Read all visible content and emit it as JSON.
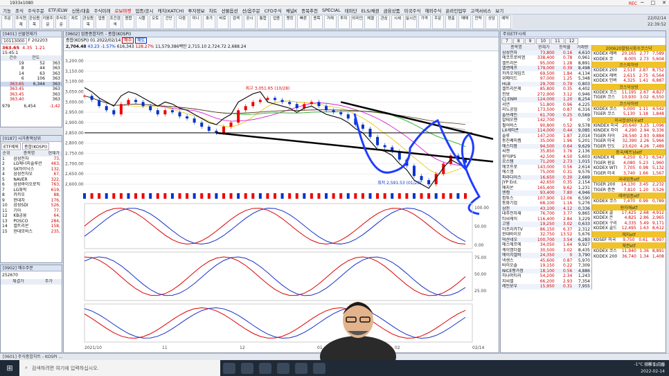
{
  "app": {
    "title": "1933x1080",
    "rec": "REC",
    "clock": [
      "22/02/14",
      "22:39:52"
    ]
  },
  "menu": [
    "기능",
    "조식",
    "주식주문",
    "ETF/ELW",
    "신용/대출",
    "주식미래",
    "로보마켓",
    "업종/공시",
    "캐치(KATCH)",
    "투자정보",
    "차트",
    "선물옵션",
    "선/옵주문",
    "CFD주식",
    "채널K",
    "종목추천",
    "SPECIAL",
    "테마단",
    "ELS/채권",
    "금융상품",
    "미국주식",
    "해외주식",
    "온라인업무",
    "고객서비스",
    "보기"
  ],
  "toolbar": [
    "주문",
    "주식현재",
    "관심종목",
    "키움주문",
    "주식주문",
    "차트",
    "관심종목",
    "업종",
    "조건검색",
    "종합",
    "시황",
    "오토",
    "간단",
    "다중",
    "미니",
    "호가",
    "바로",
    "검색",
    "공시",
    "통합",
    "업종",
    "랭킹",
    "빠른",
    "종목",
    "거래",
    "투자",
    "외국인",
    "체결",
    "관심",
    "시세",
    "실시간",
    "가격",
    "주문",
    "편출",
    "매매",
    "전략",
    "상담",
    "예약"
  ],
  "left_top": {
    "title": "[0401] 선물현재가",
    "code": "10113000",
    "name": "F 202203",
    "price": "363.65",
    "change": "4.35",
    "pct": "1.21",
    "time": "15:45:1",
    "columns": [
      "건수",
      "잔도"
    ],
    "rows": [
      [
        "19",
        "52",
        "363"
      ],
      [
        "8",
        "44",
        "363"
      ],
      [
        "14",
        "63",
        "363"
      ],
      [
        "6",
        "106",
        "363"
      ],
      [
        "363.65",
        "6,344",
        "363"
      ],
      [
        "363.45",
        "",
        "363"
      ],
      [
        "363.45",
        "",
        "363"
      ],
      [
        "363.40",
        "",
        "363"
      ]
    ],
    "sum": [
      "979",
      "6,454",
      "-1,42"
    ]
  },
  "left_mid": {
    "title": "[0187] 시가총액상위",
    "filter": "ETF제외",
    "market": "종합(KOSPI)",
    "columns": [
      "순위",
      "종목명",
      "현재가"
    ],
    "rows": [
      [
        "1",
        "삼성전자",
        "73,"
      ],
      [
        "2",
        "LG에너지솔루션",
        "463,"
      ],
      [
        "3",
        "SK하이닉스",
        "132,"
      ],
      [
        "4",
        "삼성전자우",
        "67,"
      ],
      [
        "5",
        "NAVER",
        "322,"
      ],
      [
        "6",
        "삼성바이오로직",
        "763,"
      ],
      [
        "7",
        "LG화학",
        "619,"
      ],
      [
        "8",
        "카카오",
        "88,"
      ],
      [
        "9",
        "현대차",
        "176,"
      ],
      [
        "10",
        "삼성SDI",
        "526,"
      ],
      [
        "11",
        "기아",
        "77,"
      ],
      [
        "12",
        "KB금융",
        "64,"
      ],
      [
        "13",
        "POSCO",
        "284,"
      ],
      [
        "14",
        "셀트리온",
        "158,"
      ],
      [
        "15",
        "현대모비스",
        "235,"
      ]
    ]
  },
  "left_bot": {
    "title": "[0902] 매수주문",
    "code": "252670",
    "cols": [
      "체결가",
      "주가"
    ]
  },
  "chart": {
    "title": "[0602] 업종종합차트 - 종합(KOSPI)",
    "index": "종합(KOSPI)",
    "period": "01",
    "date": "2022/02/14",
    "price": "2,704.48",
    "change": "43.23",
    "pct": "-1.57%",
    "volume": "616,343",
    "vol_pct": "128.27%",
    "amount": "11,579,386백만",
    "open": "2,715.10",
    "high": "2,724.72",
    "low": "2,688.24",
    "buy": "매수",
    "sell": "매도",
    "max_label": "최고 3,051.65 (10/28)",
    "min_label": "최저 2,591.53 (01/28)",
    "y_ticks": [
      "3,200.00",
      "3,150.00",
      "3,100.00",
      "3,050.00",
      "3,000.00",
      "2,950.00",
      "2,900.00",
      "2,850.00",
      "2,800.00",
      "2,750.00",
      "2,700.00",
      "2,650.00",
      "2,600.00"
    ],
    "x_ticks": [
      "2021/10",
      "11",
      "12",
      "01",
      "02",
      "02/14"
    ],
    "osc_ticks": [
      "100.00",
      "50.00",
      "0.00"
    ],
    "stoch_ticks": [
      "75.00",
      "50.00",
      "25.00"
    ]
  },
  "chart_data": {
    "type": "line",
    "title": "종합(KOSPI)",
    "series": [
      {
        "name": "KOSPI",
        "values": [
          3030,
          3010,
          2980,
          2960,
          2940,
          2990,
          3010,
          3000,
          2980,
          2960,
          2940,
          2960,
          2950,
          2930,
          2920,
          2900,
          2880,
          2860,
          2850,
          2880,
          2900,
          2960,
          2980,
          3000,
          3010,
          3020,
          3010,
          3000,
          2990,
          2970,
          2990,
          3000,
          2980,
          2960,
          2950,
          2940,
          2920,
          2890,
          2870,
          2830,
          2790,
          2780,
          2760,
          2720,
          2690,
          2640,
          2620,
          2600,
          2650,
          2700,
          2740,
          2720,
          2704
        ]
      }
    ],
    "ylim": [
      2580,
      3220
    ]
  },
  "status": "[0601] 주식종합차트 - KOSPI ...",
  "right": {
    "title": "주요ETF시세",
    "tabs": [
      "7",
      "8",
      "9",
      "10",
      "11",
      "12"
    ],
    "cols": [
      "종목명",
      "현재가",
      "등락률",
      "거래량"
    ],
    "rows": [
      [
        "삼성전자",
        "73,800",
        "0.16",
        "4,610"
      ],
      [
        "에코프로비엠",
        "338,400",
        "0.78",
        "0,961"
      ],
      [
        "셀트리온",
        "95,000",
        "1.28",
        "8,891"
      ],
      [
        "엘엔에프",
        "179,000",
        "0.39",
        "8,498"
      ],
      [
        "카카오게임즈",
        "69,500",
        "1.84",
        "4,134"
      ],
      [
        "위메이드",
        "97,000",
        "1.25",
        "5,348"
      ],
      [
        "HLB",
        "29,700",
        "0.79",
        "0,803"
      ],
      [
        "셀트리온제",
        "85,800",
        "0.35",
        "4,402"
      ],
      [
        "천보",
        "272,900",
        "3.12",
        "0,946"
      ],
      [
        "CJ ENM",
        "124,000",
        "1.20",
        "8,254"
      ],
      [
        "서연",
        "51,800",
        "0.96",
        "4,225"
      ],
      [
        "리노공업",
        "173,500",
        "0.87",
        "6,316"
      ],
      [
        "솔브레인",
        "61,700",
        "0.25",
        "0,569"
      ],
      [
        "알테오젠",
        "142,700",
        "0",
        "0"
      ],
      [
        "펄어비스",
        "90,800",
        "0.52",
        "9,578"
      ],
      [
        "LX세미콘",
        "114,000",
        "0.44",
        "9,085"
      ],
      [
        "솔루",
        "147,200",
        "1.87",
        "2,014"
      ],
      [
        "동진쎄미켐",
        "35,000",
        "1.96",
        "5,201"
      ],
      [
        "에스티팜",
        "94,500",
        "0.64",
        "9,629"
      ],
      [
        "씨젠",
        "35,850",
        "3.76",
        "2,136"
      ],
      [
        "원익IPS",
        "42,500",
        "4.50",
        "5,603"
      ],
      [
        "오스템",
        "71,200",
        "2.73",
        "1,015"
      ],
      [
        "에코프로",
        "143,000",
        "0.56",
        "2,614"
      ],
      [
        "에스엠",
        "75,000",
        "0.31",
        "9,576"
      ],
      [
        "파라다이스",
        "16,650",
        "0.30",
        "2,669"
      ],
      [
        "JYP Ent.",
        "42,650",
        "0.35",
        "2,154"
      ],
      [
        "메지온",
        "165,400",
        "9.62",
        "1,231"
      ],
      [
        "엔켐",
        "93,400",
        "7.80",
        "4,946"
      ],
      [
        "컴투스",
        "107,900",
        "12.06",
        "6,590"
      ],
      [
        "동화기업",
        "68,100",
        "1.16",
        "5,276"
      ],
      [
        "삼천",
        "43,100",
        "4.12",
        "0,336"
      ],
      [
        "대주전자재",
        "76,700",
        "3.77",
        "9,865"
      ],
      [
        "티씨케이",
        "116,400",
        "2.84",
        "3,229"
      ],
      [
        "고영",
        "19,250",
        "3.02",
        "0,633"
      ],
      [
        "아프리카TV",
        "86,150",
        "6.37",
        "2,312"
      ],
      [
        "현대바이오",
        "32,750",
        "13.52",
        "5,676"
      ],
      [
        "덕산네오",
        "100,700",
        "3.54",
        "6,283"
      ],
      [
        "에스에프에",
        "34,050",
        "1.64",
        "9,927"
      ],
      [
        "케이엠더블",
        "30,500",
        "3.02",
        "8,435"
      ],
      [
        "에이치엘비",
        "24,350",
        "0",
        "3,790"
      ],
      [
        "넥센스",
        "45,600",
        "0.87",
        "5,970"
      ],
      [
        "바이오솔",
        "19,150",
        "0.22",
        "7,309"
      ],
      [
        "NICE평가정",
        "18,100",
        "0.56",
        "4,886"
      ],
      [
        "하나머티리",
        "54,200",
        "2.34",
        "1,243"
      ],
      [
        "지씨셀",
        "66,200",
        "2.93",
        "7,354"
      ],
      [
        "레인보우",
        "15,950",
        "0.31",
        "7,955"
      ]
    ],
    "sub": [
      {
        "h": "종목명",
        "v": [
          "주요국가지표"
        ]
      },
      {
        "h": "",
        "v": [
          "TIGER TOP1 12,455 1.66 4,290"
        ]
      }
    ],
    "etf_sections": [
      {
        "label": "200620발림시화수코스닥",
        "rows": [
          [
            "KODEX 레버",
            "20,165",
            "2.77",
            "7,589"
          ],
          [
            "KODEX 코",
            "8,005",
            "2.73",
            "5,604"
          ]
        ]
      },
      {
        "label": "코스피하방",
        "rows": [
          [
            "KODEX 200",
            "2,510",
            "2.87",
            "8,752"
          ],
          [
            "KODEX 레버",
            "2,615",
            "2.75",
            "6,564"
          ],
          [
            "KODEX 인버",
            "4,325",
            "1.41",
            "6,887"
          ]
        ]
      },
      {
        "label": "코스닥상방",
        "rows": [
          [
            "KODEX 코스",
            "11,195",
            "2.67",
            "4,827"
          ],
          [
            "TIGER 코스",
            "10,930",
            "3.02",
            "6,550"
          ]
        ]
      },
      {
        "label": "코스닥하방",
        "rows": [
          [
            "KODEX 코스",
            "5,000",
            "1.11",
            "4,542"
          ],
          [
            "TIGER 코스",
            "5,130",
            "1.18",
            "1,848"
          ]
        ]
      },
      {
        "label": "미국합성다우etf",
        "rows": [
          [
            "KINDEX 미국",
            "20,640",
            "3.25",
            "1,096"
          ],
          [
            "KINDEX 차이",
            "4,290",
            "2.94",
            "9,336"
          ],
          [
            "TIGER 차이",
            "28,540",
            "2.93",
            "9,884"
          ],
          [
            "TIGER 미국",
            "32,390",
            "2.26",
            "5,966"
          ],
          [
            "TIGER 인도",
            "23,620",
            "4.26",
            "7,489"
          ]
        ]
      },
      {
        "label": "중국/베트남etf",
        "rows": [
          [
            "KINDEX 베",
            "4,250",
            "0.71",
            "6,547"
          ],
          [
            "TIGER 원유",
            "4,080",
            "5.23",
            "1,960"
          ],
          [
            "KODEX WTI",
            "7,705",
            "0.98",
            "5,132"
          ],
          [
            "TIGER 미국",
            "3,740",
            "1.66",
            "1,567"
          ]
        ]
      },
      {
        "label": "국내업종etf",
        "rows": [
          [
            "TIGER 200",
            "14,130",
            "3.45",
            "2,232"
          ],
          [
            "TIGER 증권",
            "7,810",
            "1.20",
            "3,526"
          ]
        ]
      },
      {
        "label": "레버업종etf",
        "rows": [
          [
            "KODEX 코스",
            "7,470",
            "0.99",
            "0,789"
          ]
        ]
      },
      {
        "label": "원자재etf",
        "rows": [
          [
            "KODEX 골",
            "17,425",
            "2.68",
            "4,912"
          ],
          [
            "KODEX 은",
            "4,825",
            "2.86",
            "2,965"
          ],
          [
            "KODEX 구리",
            "4,335",
            "5.49",
            "9,171"
          ],
          [
            "KODEX 골드",
            "12,495",
            "1.63",
            "8,612"
          ]
        ]
      },
      {
        "label": "헤지etf",
        "rows": [
          [
            "KOSEF 미국",
            "9,750",
            "0.61",
            "8,997"
          ]
        ]
      },
      {
        "label": "채권etf",
        "rows": [
          [
            "KODEX 코스",
            "11,940",
            "1.36",
            "8,891"
          ],
          [
            "KODEX 200",
            "36,740",
            "1.34",
            "1,408"
          ]
        ]
      }
    ]
  },
  "taskbar": {
    "search": "검색하려면 여기에 입력하십시오.",
    "weather": "-1°C 대체로 흐림",
    "time": "오후 10:39",
    "date": "2022-02-14"
  }
}
